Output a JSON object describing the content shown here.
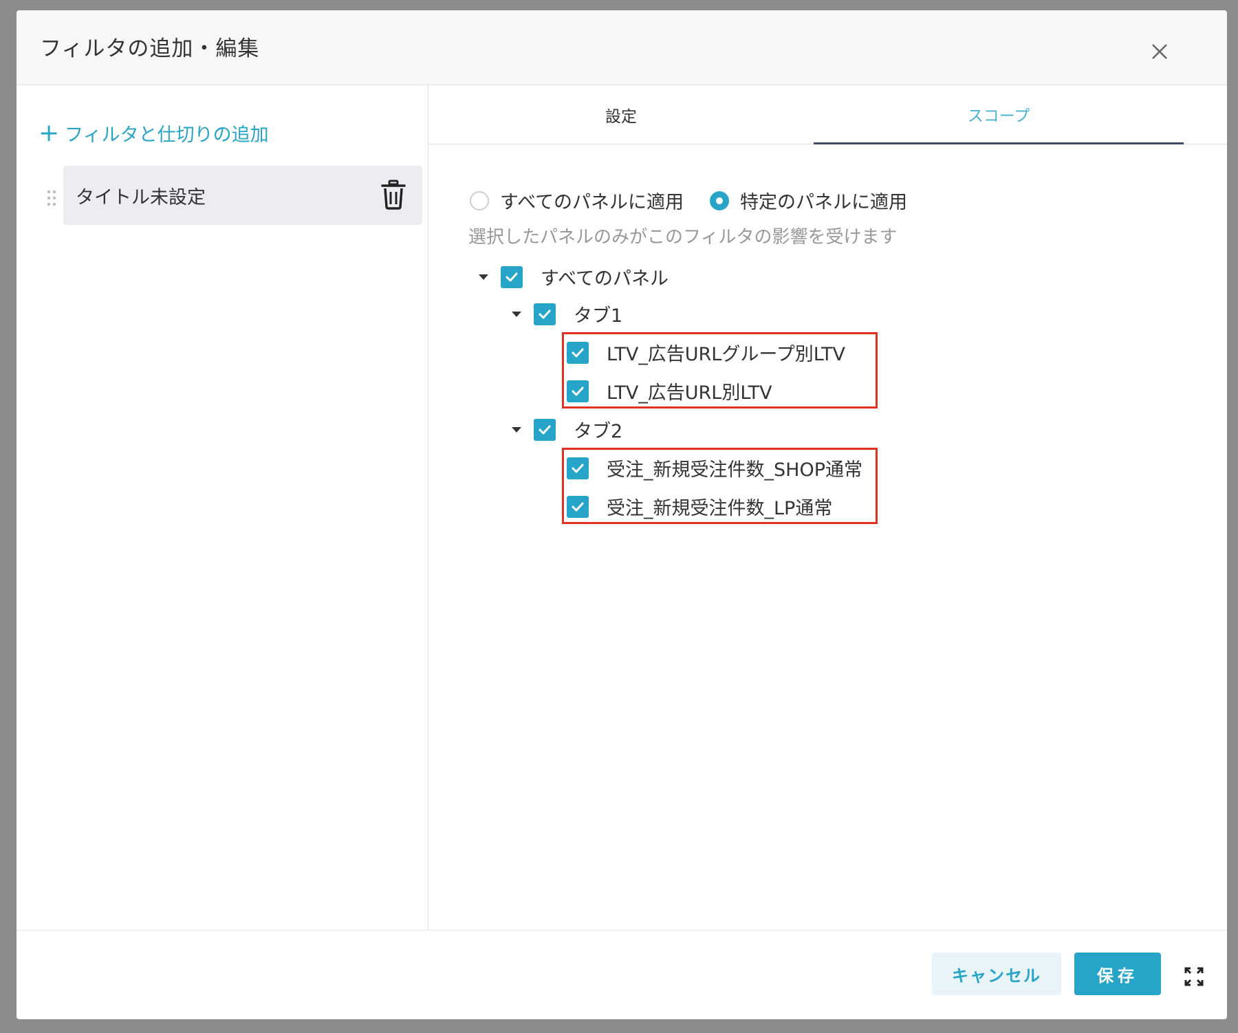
{
  "modal": {
    "title": "フィルタの追加・編集"
  },
  "left": {
    "add_filter_label": "フィルタと仕切りの追加",
    "filter_items": [
      {
        "label": "タイトル未設定"
      }
    ]
  },
  "tabs": [
    {
      "label": "設定",
      "active": false
    },
    {
      "label": "スコープ",
      "active": true
    }
  ],
  "scope": {
    "radio_all_label": "すべてのパネルに適用",
    "radio_specific_label": "特定のパネルに適用",
    "selected_radio": "specific",
    "hint": "選択したパネルのみがこのフィルタの影響を受けます",
    "tree": {
      "label": "すべてのパネル",
      "checked": true,
      "children": [
        {
          "label": "タブ1",
          "checked": true,
          "panels": [
            {
              "label": "LTV_広告URLグループ別LTV",
              "checked": true
            },
            {
              "label": "LTV_広告URL別LTV",
              "checked": true
            }
          ]
        },
        {
          "label": "タブ2",
          "checked": true,
          "panels": [
            {
              "label": "受注_新規受注件数_SHOP通常",
              "checked": true
            },
            {
              "label": "受注_新規受注件数_LP通常",
              "checked": true
            }
          ]
        }
      ]
    }
  },
  "footer": {
    "cancel_label": "キャンセル",
    "save_label": "保存"
  },
  "colors": {
    "accent": "#27a5c9",
    "highlight_border": "#e0321f",
    "tab_underline": "#3d4a66"
  }
}
